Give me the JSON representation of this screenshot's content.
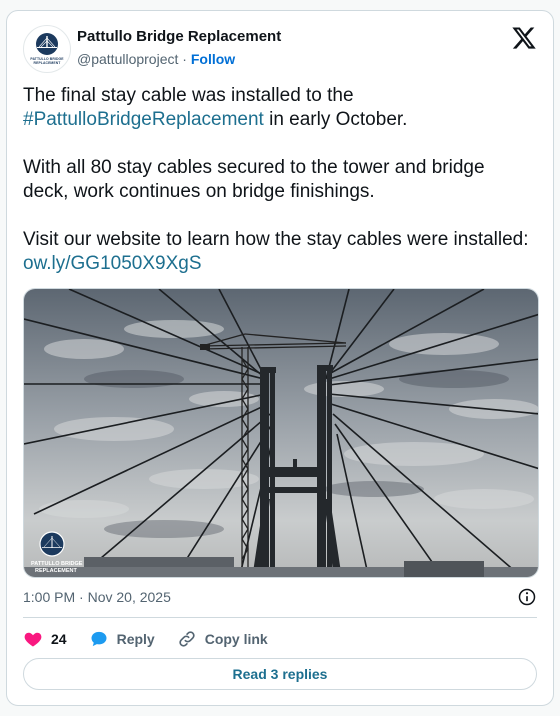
{
  "author": {
    "display_name": "Pattullo Bridge Replacement",
    "handle": "@pattulloproject",
    "separator": "·",
    "follow_label": "Follow",
    "avatar_text": "PATTULLO BRIDGE REPLACEMENT"
  },
  "post": {
    "line1_pre": "The final stay cable was installed to the",
    "hashtag": "#PattulloBridgeReplacement",
    "line1_post": "in early October.",
    "paragraph2": "With all 80 stay cables secured to the tower and bridge deck, work continues on bridge finishings.",
    "paragraph3_pre": "Visit our website to learn how the stay cables were installed:",
    "link": "ow.ly/GG1050X9XgS"
  },
  "media": {
    "watermark_text_1": "PATTULLO BRIDGE",
    "watermark_text_2": "REPLACEMENT"
  },
  "meta": {
    "timestamp": "1:00 PM · Nov 20, 2025"
  },
  "actions": {
    "like_count": "24",
    "reply_label": "Reply",
    "copy_link_label": "Copy link"
  },
  "replies_button": {
    "label": "Read 3 replies"
  },
  "colors": {
    "link": "#1d6f8f",
    "like": "#f91880",
    "reply": "#1d9bf0",
    "brand": "#1c3a5e"
  }
}
